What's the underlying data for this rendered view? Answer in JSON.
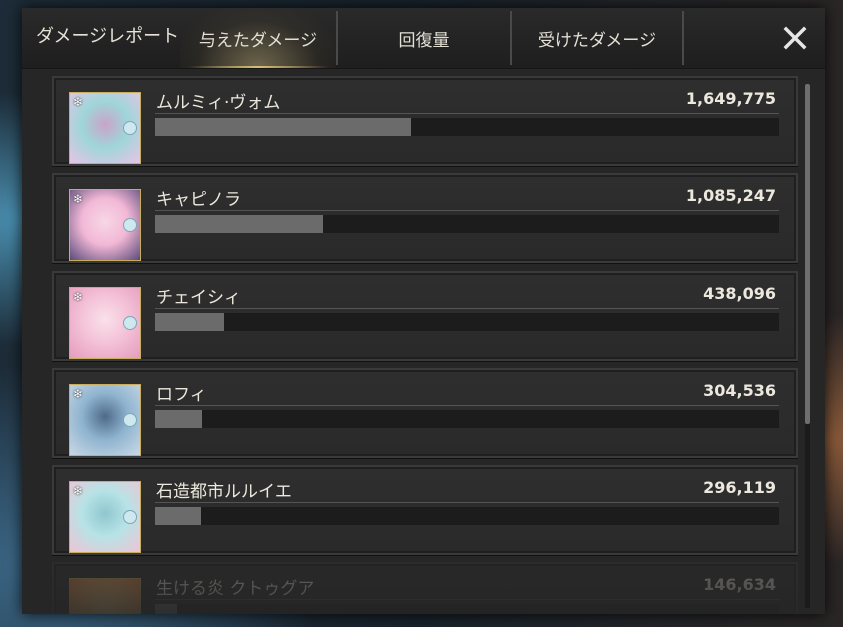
{
  "header": {
    "title": "ダメージレポート",
    "tabs": [
      {
        "label": "与えたダメージ",
        "active": true
      },
      {
        "label": "回復量",
        "active": false
      },
      {
        "label": "受けたダメージ",
        "active": false
      }
    ],
    "close_icon": "close-icon"
  },
  "colors": {
    "panel_bg": "#262626",
    "row_bg": "#2c2c2c",
    "bar_fill": "#6b6b6b",
    "bar_track": "#1c1c1c",
    "active_tab_glow": "#d6be78",
    "avatar_frame": "#c9ae62",
    "text": "#ece8de"
  },
  "rows": [
    {
      "name": "ムルミィ·ヴォム",
      "value": "1,649,775",
      "fraction": 0.41,
      "avatar_colors": [
        "#9fd6da",
        "#e7c4e6",
        "#caa3c9"
      ]
    },
    {
      "name": "キャピノラ",
      "value": "1,085,247",
      "fraction": 0.27,
      "avatar_colors": [
        "#f2b8d6",
        "#5a4a7a",
        "#f7d7e6"
      ]
    },
    {
      "name": "チェイシィ",
      "value": "438,096",
      "fraction": 0.11,
      "avatar_colors": [
        "#f4c3d8",
        "#e59cbc",
        "#f9e1ea"
      ]
    },
    {
      "name": "ロフィ",
      "value": "304,536",
      "fraction": 0.075,
      "avatar_colors": [
        "#8fb4cf",
        "#c9d8e6",
        "#4e6a8a"
      ]
    },
    {
      "name": "石造都市ルルイエ",
      "value": "296,119",
      "fraction": 0.073,
      "avatar_colors": [
        "#b7e3e6",
        "#f0c3d4",
        "#8fc7cf"
      ]
    },
    {
      "name": "生ける炎 クトゥグア",
      "value": "146,634",
      "fraction": 0.036,
      "avatar_colors": [
        "#f0b060",
        "#e07a3a",
        "#f6d08a"
      ]
    }
  ]
}
